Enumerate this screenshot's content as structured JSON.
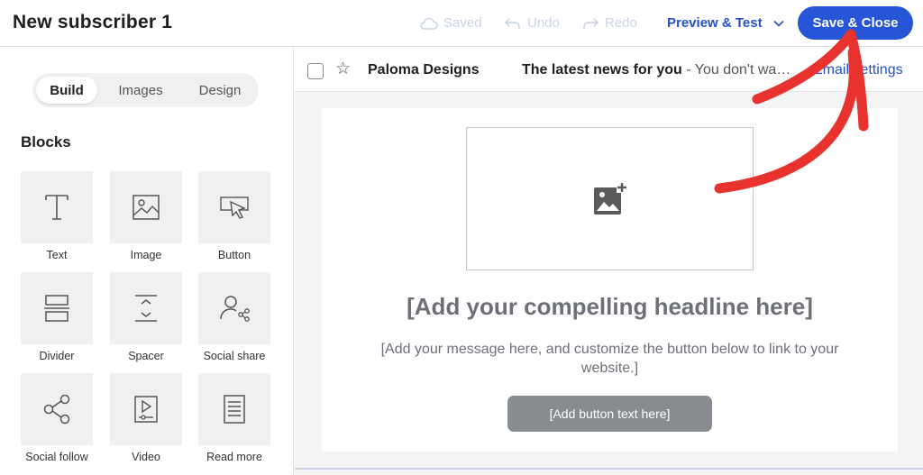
{
  "header": {
    "title": "New subscriber 1",
    "saved_label": "Saved",
    "undo_label": "Undo",
    "redo_label": "Redo",
    "preview_label": "Preview & Test",
    "save_close_label": "Save & Close"
  },
  "sidebar": {
    "tabs": [
      {
        "label": "Build",
        "active": true
      },
      {
        "label": "Images",
        "active": false
      },
      {
        "label": "Design",
        "active": false
      }
    ],
    "blocks_title": "Blocks",
    "blocks": [
      {
        "label": "Text",
        "icon": "text-icon"
      },
      {
        "label": "Image",
        "icon": "image-icon"
      },
      {
        "label": "Button",
        "icon": "button-icon"
      },
      {
        "label": "Divider",
        "icon": "divider-icon"
      },
      {
        "label": "Spacer",
        "icon": "spacer-icon"
      },
      {
        "label": "Social share",
        "icon": "social-share-icon"
      },
      {
        "label": "Social follow",
        "icon": "social-follow-icon"
      },
      {
        "label": "Video",
        "icon": "video-icon"
      },
      {
        "label": "Read more",
        "icon": "read-more-icon"
      }
    ]
  },
  "inbox_preview": {
    "sender": "Paloma Designs",
    "subject": "The latest news for you",
    "snippet": " - You don't wa…",
    "email_settings_link": "Email settings"
  },
  "email": {
    "headline": "[Add your compelling headline here]",
    "message": "[Add your message here, and customize the button below to link to your website.]",
    "button_text": "[Add button text here]"
  },
  "colors": {
    "accent": "#2655d8",
    "annotation_arrow": "#e8322d",
    "placeholder_text": "#6d7078",
    "placeholder_button": "#888c91"
  }
}
